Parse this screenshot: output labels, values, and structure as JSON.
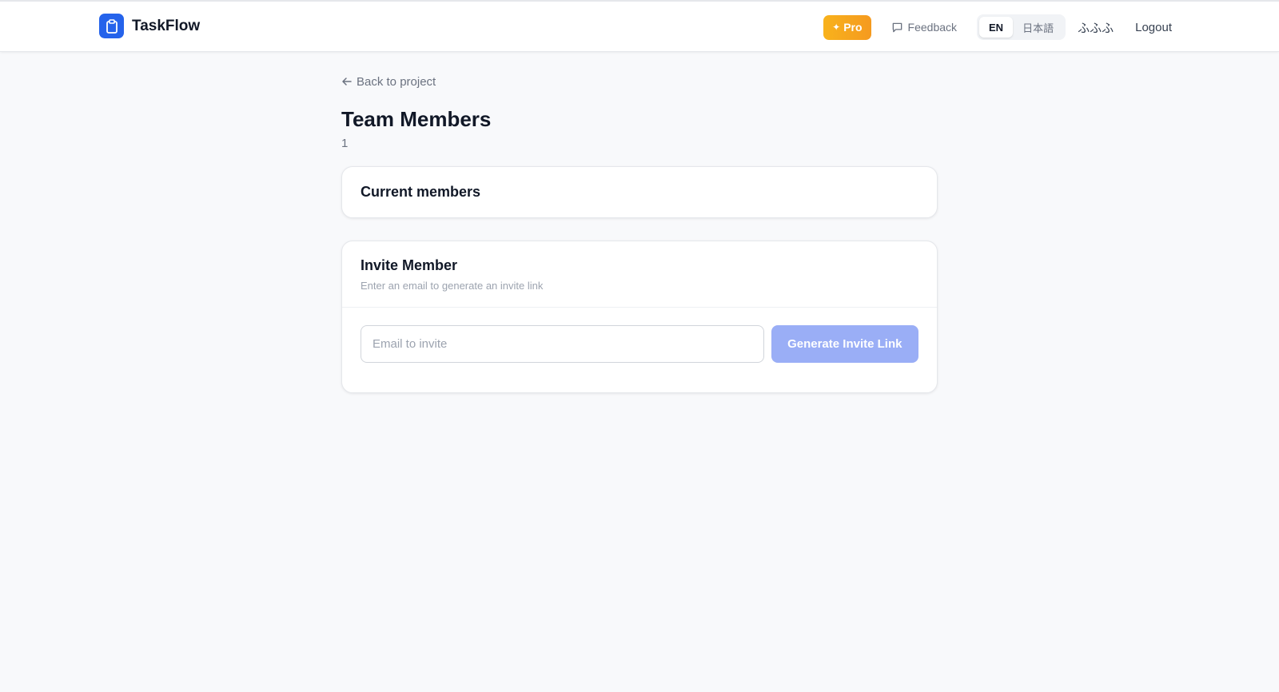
{
  "header": {
    "brand_name": "TaskFlow",
    "brand_icon": "clipboard-icon",
    "brand_color": "#2563eb",
    "pro_label": "Pro",
    "pro_icon": "sparkle-icon",
    "feedback_label": "Feedback",
    "feedback_icon": "message-square-icon",
    "languages": [
      {
        "label": "EN",
        "active": true
      },
      {
        "label": "日本語",
        "active": false
      }
    ],
    "user_name": "ふふふ",
    "logout_label": "Logout"
  },
  "main": {
    "back_label": "Back to project",
    "back_icon": "arrow-left-icon",
    "title": "Team Members",
    "member_count": "1",
    "current_members_title": "Current members",
    "invite": {
      "title": "Invite Member",
      "subtitle": "Enter an email to generate an invite link",
      "email_placeholder": "Email to invite",
      "email_value": "",
      "button_label": "Generate Invite Link",
      "button_color": "#9aaef6",
      "button_disabled": true
    }
  }
}
